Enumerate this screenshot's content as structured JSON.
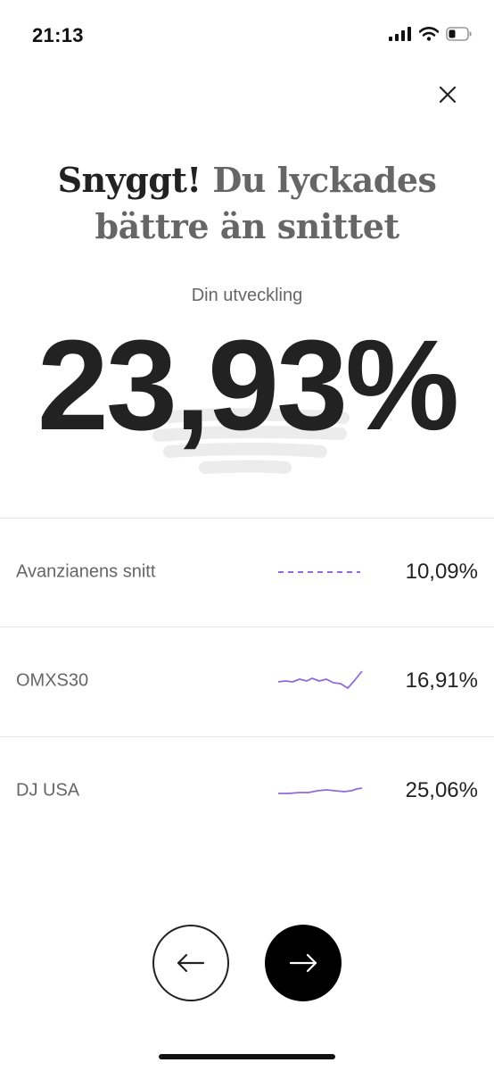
{
  "status_bar": {
    "time": "21:13",
    "icons": [
      "signal-icon",
      "wifi-icon",
      "battery-icon"
    ]
  },
  "headline": {
    "strong": "Snyggt!",
    "rest": "Du lyckades bättre än snittet"
  },
  "development": {
    "label": "Din utveckling",
    "value": "23,93%"
  },
  "comparisons": [
    {
      "name": "Avanzianens snitt",
      "value": "10,09%",
      "sparkline": "dashed"
    },
    {
      "name": "OMXS30",
      "value": "16,91%",
      "sparkline": "line"
    },
    {
      "name": "DJ USA",
      "value": "25,06%",
      "sparkline": "line"
    }
  ],
  "colors": {
    "accent": "#8e6bd8",
    "text_dark": "#222222",
    "text_muted": "#666666",
    "button_dark": "#000000"
  },
  "nav": {
    "back_icon": "arrow-left-icon",
    "next_icon": "arrow-right-icon",
    "close_icon": "close-icon"
  }
}
